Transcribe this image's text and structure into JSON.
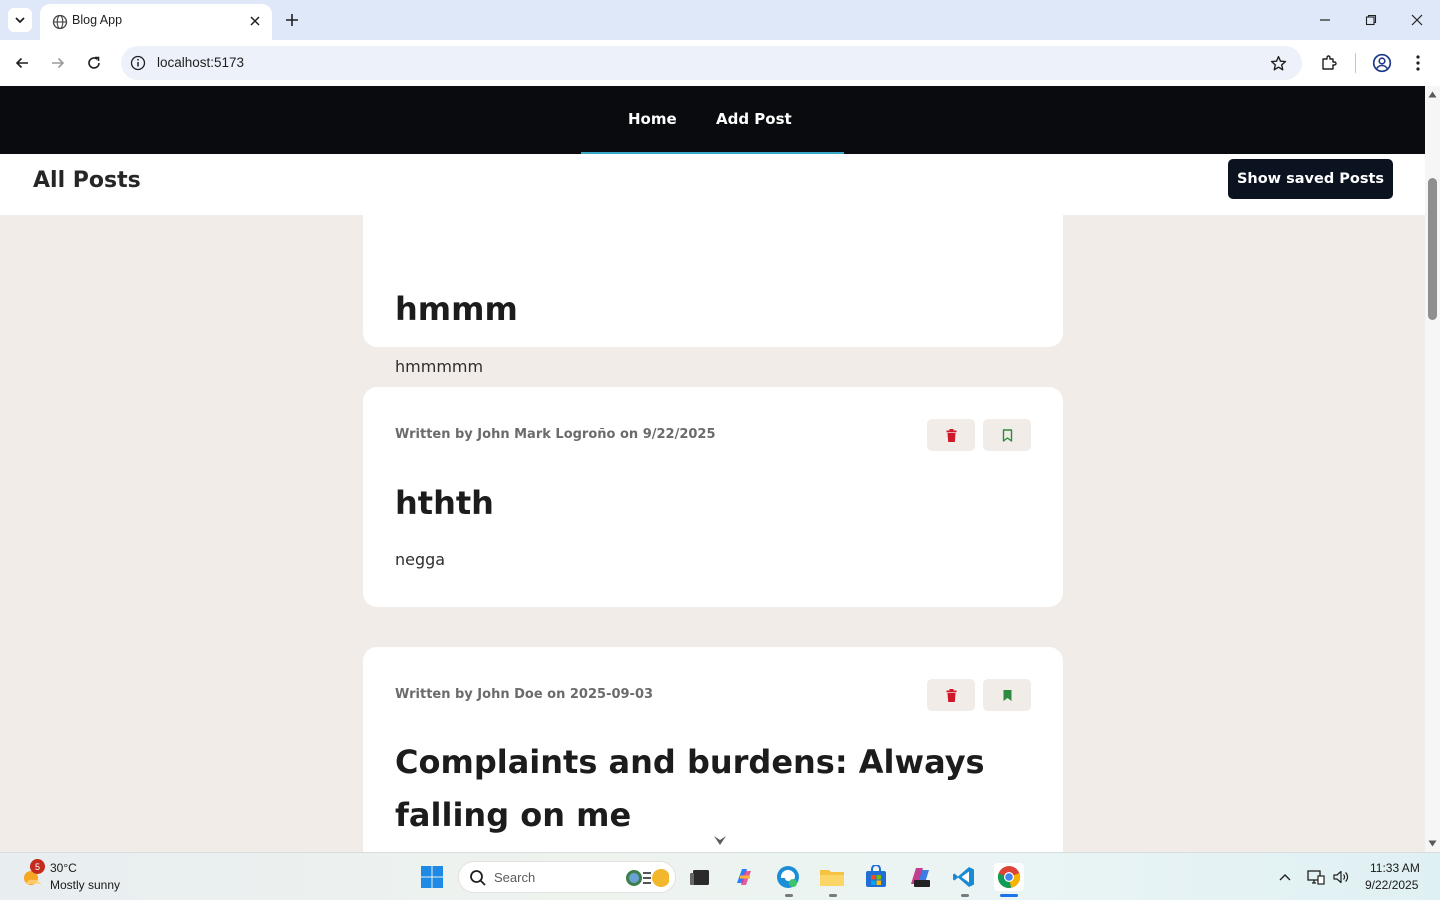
{
  "browser": {
    "tab_title": "Blog App",
    "url": "localhost:5173"
  },
  "nav": {
    "links": [
      "Home",
      "Add Post"
    ]
  },
  "header": {
    "title": "All Posts",
    "saved_button": "Show saved Posts"
  },
  "posts": [
    {
      "meta": "",
      "title": "hmmm",
      "body": "hmmmmm"
    },
    {
      "meta": "Written by John Mark Logroño on 9/22/2025",
      "title": "hthth",
      "body": "negga"
    },
    {
      "meta": "Written by John Doe on 2025-09-03",
      "title": "Complaints and burdens: Always falling on me",
      "body": ""
    }
  ],
  "taskbar": {
    "weather_badge": "5",
    "temperature": "30°C",
    "condition": "Mostly sunny",
    "search_placeholder": "Search",
    "time": "11:33 AM",
    "date": "9/22/2025"
  },
  "colors": {
    "nav_bg": "#0a0b0e",
    "page_bg": "#f1ece8",
    "delete_icon": "#d0182b",
    "bookmark_icon": "#2e8b3e",
    "nav_underline": "#3aa9c9"
  }
}
